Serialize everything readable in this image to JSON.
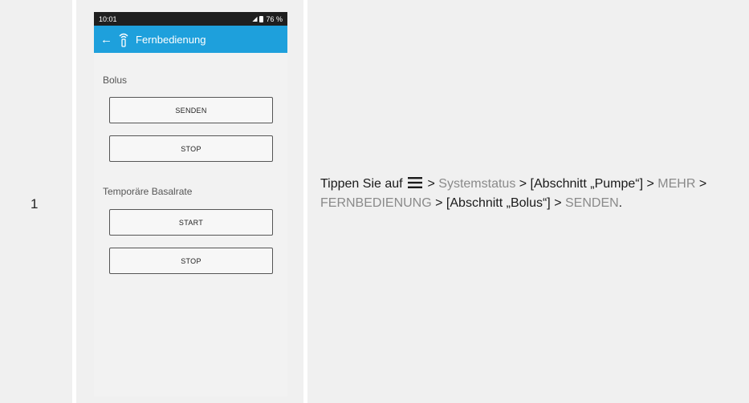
{
  "step": {
    "number": "1"
  },
  "phone": {
    "status": {
      "time": "10:01",
      "battery": "76 %"
    },
    "appbar": {
      "title": "Fernbedienung"
    },
    "bolus": {
      "label": "Bolus",
      "send_button": "SENDEN",
      "stop_button": "STOP"
    },
    "temp_basal": {
      "label": "Temporäre Basalrate",
      "start_button": "START",
      "stop_button": "STOP"
    }
  },
  "instruction": {
    "prefix": "Tippen Sie auf",
    "sep1": " > ",
    "systemstatus": "Systemstatus",
    "sep2": " > [Abschnitt „Pumpe“] > ",
    "mehr": "MEHR",
    "sep3": " > ",
    "fernbedienung": "FERNBEDIENUNG",
    "sep4": " > [Abschnitt „Bolus“] > ",
    "senden": "SENDEN",
    "suffix": "."
  },
  "colors": {
    "appbar": "#1ea0dc",
    "ui_text": "#8a8a8a"
  }
}
